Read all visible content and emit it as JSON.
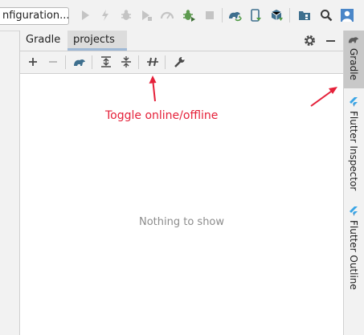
{
  "toolbar": {
    "run_config_label": "nfiguration...",
    "icons": [
      "run-icon",
      "apply-changes-icon",
      "debug-icon",
      "coverage-icon",
      "profile-icon",
      "attach-debugger-icon",
      "stop-icon",
      "gradle-sync-icon",
      "device-manager-icon",
      "sdk-manager-icon",
      "project-structure-icon",
      "search-icon",
      "user-avatar-icon"
    ]
  },
  "tool_window": {
    "tabs": [
      {
        "label": "Gradle",
        "selected": false
      },
      {
        "label": "projects",
        "selected": true
      }
    ],
    "empty_text": "Nothing to show"
  },
  "annotation": {
    "text": "Toggle online/offline",
    "color": "#e5213a"
  },
  "side_stripe": {
    "items": [
      {
        "label": "Gradle",
        "active": true
      },
      {
        "label": "Flutter Inspector",
        "active": false
      },
      {
        "label": "Flutter Outline",
        "active": false
      }
    ]
  },
  "colors": {
    "accent_green": "#4f9a46",
    "accent_blue": "#3e86c8",
    "flutter_blue": "#3aa5e6",
    "annotation_red": "#e5213a"
  }
}
